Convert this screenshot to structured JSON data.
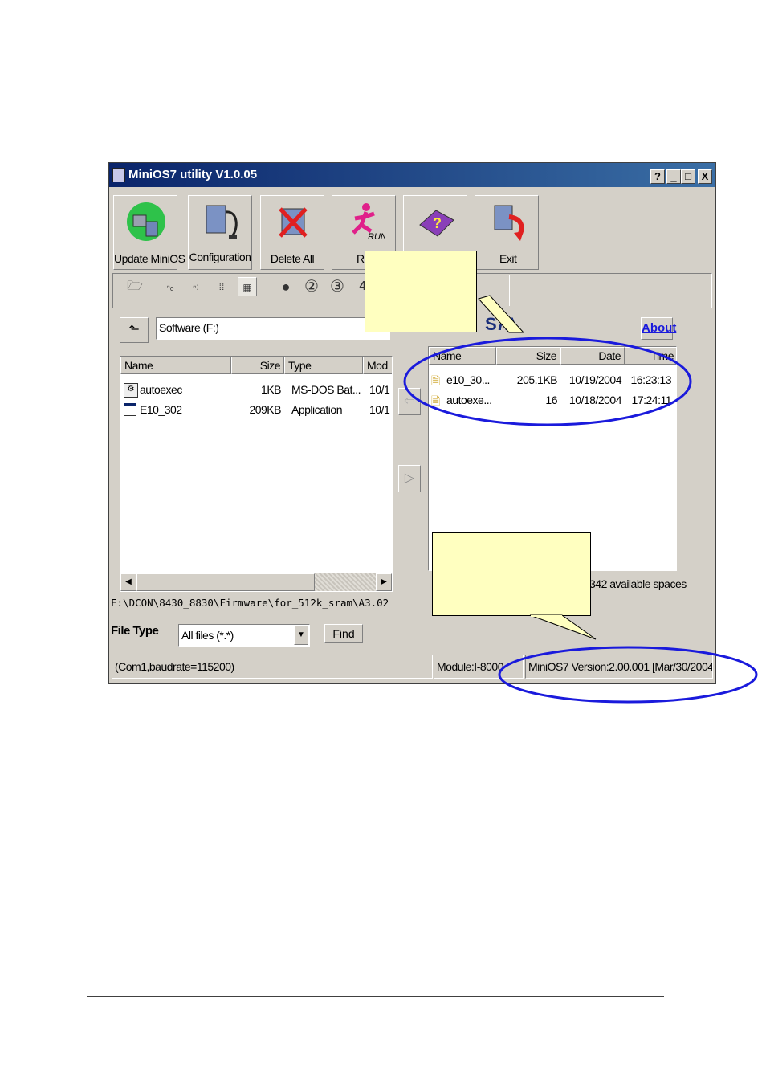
{
  "window": {
    "title": "MiniOS7 utility V1.0.05",
    "help_btn": "?",
    "min_btn": "_",
    "max_btn": "□",
    "close_btn": "X"
  },
  "toolbar": {
    "buttons": [
      {
        "label": "Update MiniOS",
        "icon": "update-minios-icon"
      },
      {
        "label": "Configuration",
        "icon": "configuration-icon"
      },
      {
        "label": "Delete All",
        "icon": "delete-all-icon"
      },
      {
        "label": "Ru",
        "icon": "run-icon"
      },
      {
        "label": "",
        "icon": "help-book-icon"
      },
      {
        "label": "Exit",
        "icon": "exit-icon"
      }
    ],
    "small_icons": [
      "open-folder-icon",
      "large-icons-view-icon",
      "small-icons-view-icon",
      "list-view-icon",
      "details-view-icon",
      "disconnect-icon",
      "com2-icon",
      "com3-icon",
      "com4-icon"
    ],
    "com_labels": [
      "②",
      "③",
      "4"
    ]
  },
  "left_panel": {
    "drive": "Software (F:)",
    "columns": [
      "Name",
      "Size",
      "Type",
      "Mod"
    ],
    "files": [
      {
        "name": "autoexec",
        "size": "1KB",
        "type": "MS-DOS Bat...",
        "mod": "10/1"
      },
      {
        "name": "E10_302",
        "size": "209KB",
        "type": "Application",
        "mod": "10/1"
      }
    ],
    "path": "F:\\DCON\\8430_8830\\Firmware\\for_512k_sram\\A3.02",
    "file_type_label": "File Type",
    "file_type_value": "All files (*.*)",
    "find_button": "Find"
  },
  "right_panel": {
    "banner": "S7A",
    "about_button": "About",
    "columns": [
      "Name",
      "Size",
      "Date",
      "Time"
    ],
    "files": [
      {
        "name": "e10_30...",
        "size": "205.1KB",
        "date": "10/19/2004",
        "time": "16:23:13"
      },
      {
        "name": "autoexe...",
        "size": "16",
        "date": "10/18/2004",
        "time": "17:24:11"
      }
    ],
    "available": "342 available spaces"
  },
  "status_bar": {
    "connection": "(Com1,baudrate=115200)",
    "module": "Module:I-8000",
    "version": "MiniOS7 Version:2.00.001 [Mar/30/2004]"
  },
  "colors": {
    "titlebar": "#0a246a",
    "callout": "#ffffc0",
    "highlight_ellipse": "#1a1adc",
    "window_face": "#d4d0c8"
  }
}
